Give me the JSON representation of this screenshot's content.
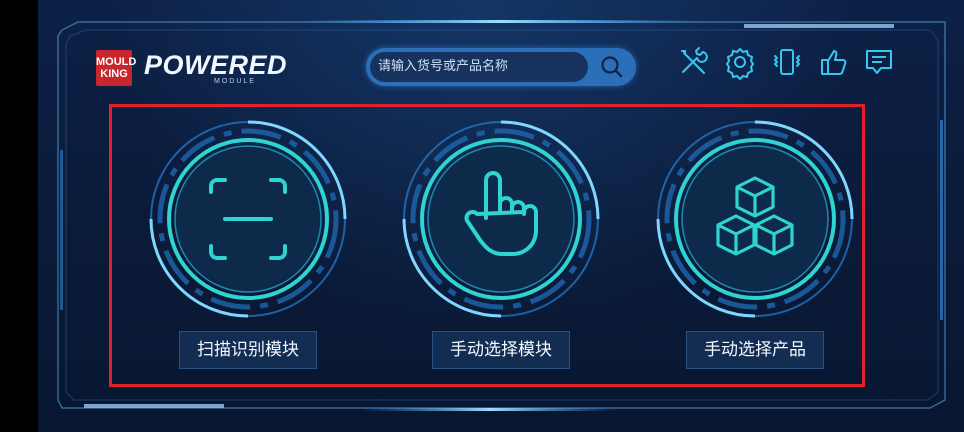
{
  "brand": {
    "badge_lines": [
      "MOULD",
      "KING"
    ],
    "powered": "POWERED",
    "module": "MODULE"
  },
  "search": {
    "placeholder": "请输入货号或产品名称"
  },
  "toolbar": {
    "icons": [
      "tools-icon",
      "gear-icon",
      "phone-vibrate-icon",
      "thumbs-up-icon",
      "message-icon"
    ]
  },
  "modes": [
    {
      "label": "扫描识别模块",
      "icon": "scan-icon"
    },
    {
      "label": "手动选择模块",
      "icon": "hand-pointer-icon"
    },
    {
      "label": "手动选择产品",
      "icon": "cubes-icon"
    }
  ],
  "colors": {
    "accent": "#2fd3d0",
    "ring": "#1e8fe0",
    "highlight_box": "#e0202a"
  }
}
